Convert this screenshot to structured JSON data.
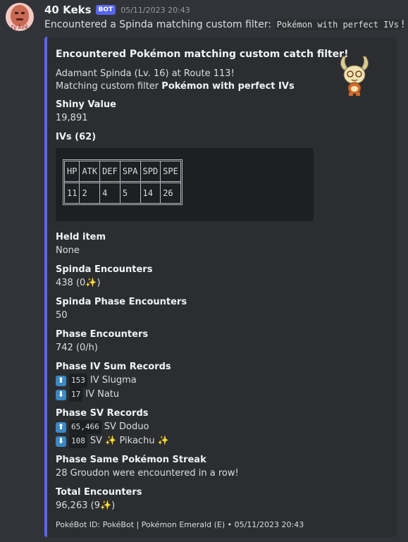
{
  "message": {
    "username": "40 Keks",
    "badge": "BOT",
    "timestamp": "05/11/2023 20:43",
    "avatar_text": "ty kek",
    "text_prefix": "Encountered a Spinda matching custom filter:",
    "filter_code": "Pokémon with perfect IVs",
    "text_suffix": "!"
  },
  "embed": {
    "accent_color": "#5865f2",
    "title": "Encountered Pokémon matching custom catch filter!",
    "desc_line1": "Adamant Spinda (Lv. 16) at Route 113!",
    "desc_line2_prefix": "Matching custom filter",
    "desc_line2_bold": "Pokémon with perfect IVs",
    "thumbnail_icon": "spinda-sprite",
    "shiny_value": {
      "name": "Shiny Value",
      "value": "19,891"
    },
    "ivs": {
      "name": "IVs (62)",
      "headers": [
        "HP",
        "ATK",
        "DEF",
        "SPA",
        "SPD",
        "SPE"
      ],
      "values": [
        "11",
        "2",
        "4",
        "5",
        "14",
        "26"
      ]
    },
    "held_item": {
      "name": "Held item",
      "value": "None"
    },
    "spinda_encounters": {
      "name": "Spinda Encounters",
      "value_prefix": "438 (0",
      "value_suffix": ")"
    },
    "spinda_phase": {
      "name": "Spinda Phase Encounters",
      "value": "50"
    },
    "phase_encounters": {
      "name": "Phase Encounters",
      "value": "742 (0/h)"
    },
    "iv_records": {
      "name": "Phase IV Sum Records",
      "up_num": "153",
      "up_text": "IV Slugma",
      "down_num": "17",
      "down_text": "IV Natu"
    },
    "sv_records": {
      "name": "Phase SV Records",
      "up_num": "65,466",
      "up_text": "SV Doduo",
      "down_num": "108",
      "down_text_prefix": "SV",
      "down_text_name": "Pikachu"
    },
    "streak": {
      "name": "Phase Same Pokémon Streak",
      "value": "28 Groudon were encountered in a row!"
    },
    "total": {
      "name": "Total Encounters",
      "value_prefix": "96,263 (9",
      "value_suffix": ")"
    },
    "footer": "PokéBot ID: PokéBot | Pokémon Emerald (E) • 05/11/2023 20:43"
  },
  "icons": {
    "up": "up-arrow-icon",
    "down": "down-arrow-icon",
    "sparkle": "sparkles-icon"
  }
}
